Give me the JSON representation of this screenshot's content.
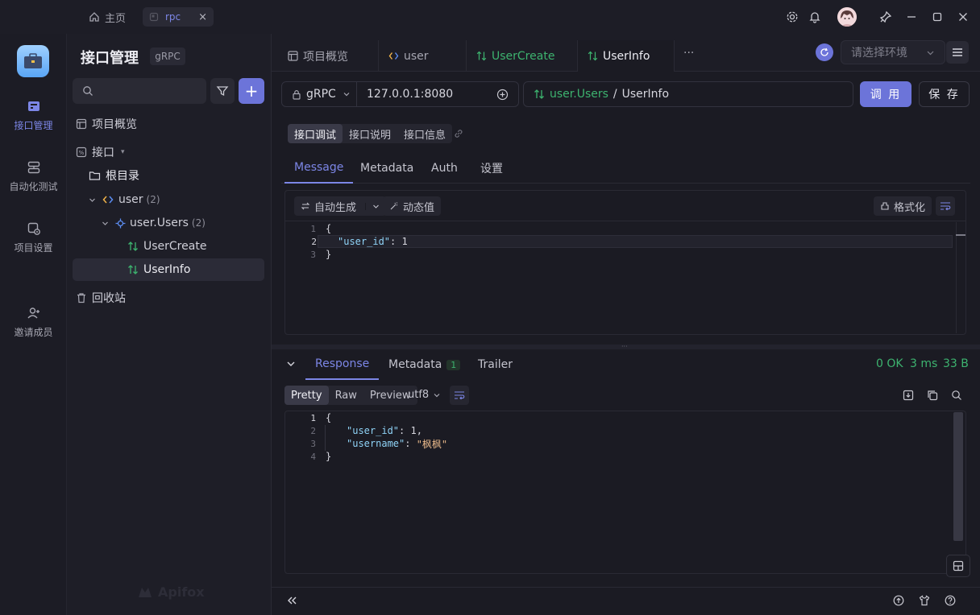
{
  "titlebar": {
    "home_label": "主页",
    "tab_label": "rpc",
    "tab_close": "×"
  },
  "rail": {
    "items": [
      {
        "label": "接口管理",
        "icon": "api-management-icon",
        "active": true
      },
      {
        "label": "自动化测试",
        "icon": "automation-test-icon"
      },
      {
        "label": "项目设置",
        "icon": "project-settings-icon"
      },
      {
        "label": "邀请成员",
        "icon": "invite-member-icon"
      }
    ]
  },
  "sidebar": {
    "title": "接口管理",
    "badge": "gRPC",
    "add_label": "+",
    "tree": [
      {
        "label": "项目概览"
      },
      {
        "label": "接口",
        "caret": "▾"
      },
      {
        "label": "根目录"
      },
      {
        "label": "user",
        "count": "(2)"
      },
      {
        "label": "user.Users",
        "count": "(2)"
      },
      {
        "label": "UserCreate"
      },
      {
        "label": "UserInfo",
        "selected": true
      },
      {
        "label": "回收站"
      }
    ],
    "watermark": "Apifox"
  },
  "main": {
    "tabs": [
      {
        "label": "项目概览"
      },
      {
        "label": "user"
      },
      {
        "label": "UserCreate"
      },
      {
        "label": "UserInfo",
        "active": true
      }
    ],
    "more": "···",
    "env_placeholder": "请选择环境"
  },
  "request": {
    "protocol": "gRPC",
    "url": "127.0.0.1:8080",
    "service": "user.Users",
    "separator": "/",
    "method": "UserInfo",
    "call_label": "调 用",
    "save_label": "保 存"
  },
  "mode_tabs": [
    "接口调试",
    "接口说明",
    "接口信息"
  ],
  "req_tabs": [
    "Message",
    "Metadata",
    "Auth",
    "设置"
  ],
  "req_tools": {
    "auto_gen": "自动生成",
    "dynamic": "动态值",
    "format": "格式化"
  },
  "req_code": [
    {
      "n": "1",
      "text": "{"
    },
    {
      "n": "2",
      "key": "\"user_id\"",
      "val": "1"
    },
    {
      "n": "3",
      "text": "}"
    }
  ],
  "response": {
    "tabs": {
      "response": "Response",
      "metadata": "Metadata",
      "metadata_count": "1",
      "trailer": "Trailer"
    },
    "status": "0 OK",
    "time": "3 ms",
    "size": "33 B",
    "views": [
      "Pretty",
      "Raw",
      "Preview"
    ],
    "encoding": "utf8",
    "code": [
      {
        "n": "1",
        "text": "{"
      },
      {
        "n": "2",
        "key": "\"user_id\"",
        "val": "1,"
      },
      {
        "n": "3",
        "key": "\"username\"",
        "val": "\"枫枫\""
      },
      {
        "n": "4",
        "text": "}"
      }
    ]
  },
  "colors": {
    "accent": "#6c74d9",
    "ok": "#3db36f"
  }
}
